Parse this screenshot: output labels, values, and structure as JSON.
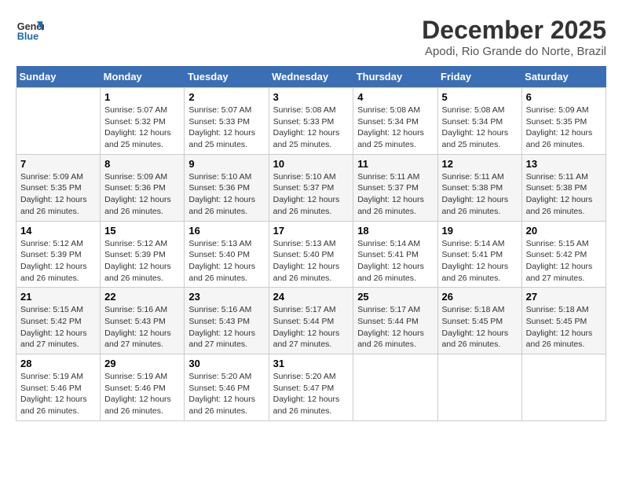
{
  "header": {
    "logo_line1": "General",
    "logo_line2": "Blue",
    "title": "December 2025",
    "subtitle": "Apodi, Rio Grande do Norte, Brazil"
  },
  "calendar": {
    "days_of_week": [
      "Sunday",
      "Monday",
      "Tuesday",
      "Wednesday",
      "Thursday",
      "Friday",
      "Saturday"
    ],
    "weeks": [
      [
        {
          "day": "",
          "info": ""
        },
        {
          "day": "1",
          "info": "Sunrise: 5:07 AM\nSunset: 5:32 PM\nDaylight: 12 hours\nand 25 minutes."
        },
        {
          "day": "2",
          "info": "Sunrise: 5:07 AM\nSunset: 5:33 PM\nDaylight: 12 hours\nand 25 minutes."
        },
        {
          "day": "3",
          "info": "Sunrise: 5:08 AM\nSunset: 5:33 PM\nDaylight: 12 hours\nand 25 minutes."
        },
        {
          "day": "4",
          "info": "Sunrise: 5:08 AM\nSunset: 5:34 PM\nDaylight: 12 hours\nand 25 minutes."
        },
        {
          "day": "5",
          "info": "Sunrise: 5:08 AM\nSunset: 5:34 PM\nDaylight: 12 hours\nand 25 minutes."
        },
        {
          "day": "6",
          "info": "Sunrise: 5:09 AM\nSunset: 5:35 PM\nDaylight: 12 hours\nand 26 minutes."
        }
      ],
      [
        {
          "day": "7",
          "info": "Sunrise: 5:09 AM\nSunset: 5:35 PM\nDaylight: 12 hours\nand 26 minutes."
        },
        {
          "day": "8",
          "info": "Sunrise: 5:09 AM\nSunset: 5:36 PM\nDaylight: 12 hours\nand 26 minutes."
        },
        {
          "day": "9",
          "info": "Sunrise: 5:10 AM\nSunset: 5:36 PM\nDaylight: 12 hours\nand 26 minutes."
        },
        {
          "day": "10",
          "info": "Sunrise: 5:10 AM\nSunset: 5:37 PM\nDaylight: 12 hours\nand 26 minutes."
        },
        {
          "day": "11",
          "info": "Sunrise: 5:11 AM\nSunset: 5:37 PM\nDaylight: 12 hours\nand 26 minutes."
        },
        {
          "day": "12",
          "info": "Sunrise: 5:11 AM\nSunset: 5:38 PM\nDaylight: 12 hours\nand 26 minutes."
        },
        {
          "day": "13",
          "info": "Sunrise: 5:11 AM\nSunset: 5:38 PM\nDaylight: 12 hours\nand 26 minutes."
        }
      ],
      [
        {
          "day": "14",
          "info": "Sunrise: 5:12 AM\nSunset: 5:39 PM\nDaylight: 12 hours\nand 26 minutes."
        },
        {
          "day": "15",
          "info": "Sunrise: 5:12 AM\nSunset: 5:39 PM\nDaylight: 12 hours\nand 26 minutes."
        },
        {
          "day": "16",
          "info": "Sunrise: 5:13 AM\nSunset: 5:40 PM\nDaylight: 12 hours\nand 26 minutes."
        },
        {
          "day": "17",
          "info": "Sunrise: 5:13 AM\nSunset: 5:40 PM\nDaylight: 12 hours\nand 26 minutes."
        },
        {
          "day": "18",
          "info": "Sunrise: 5:14 AM\nSunset: 5:41 PM\nDaylight: 12 hours\nand 26 minutes."
        },
        {
          "day": "19",
          "info": "Sunrise: 5:14 AM\nSunset: 5:41 PM\nDaylight: 12 hours\nand 26 minutes."
        },
        {
          "day": "20",
          "info": "Sunrise: 5:15 AM\nSunset: 5:42 PM\nDaylight: 12 hours\nand 27 minutes."
        }
      ],
      [
        {
          "day": "21",
          "info": "Sunrise: 5:15 AM\nSunset: 5:42 PM\nDaylight: 12 hours\nand 27 minutes."
        },
        {
          "day": "22",
          "info": "Sunrise: 5:16 AM\nSunset: 5:43 PM\nDaylight: 12 hours\nand 27 minutes."
        },
        {
          "day": "23",
          "info": "Sunrise: 5:16 AM\nSunset: 5:43 PM\nDaylight: 12 hours\nand 27 minutes."
        },
        {
          "day": "24",
          "info": "Sunrise: 5:17 AM\nSunset: 5:44 PM\nDaylight: 12 hours\nand 27 minutes."
        },
        {
          "day": "25",
          "info": "Sunrise: 5:17 AM\nSunset: 5:44 PM\nDaylight: 12 hours\nand 26 minutes."
        },
        {
          "day": "26",
          "info": "Sunrise: 5:18 AM\nSunset: 5:45 PM\nDaylight: 12 hours\nand 26 minutes."
        },
        {
          "day": "27",
          "info": "Sunrise: 5:18 AM\nSunset: 5:45 PM\nDaylight: 12 hours\nand 26 minutes."
        }
      ],
      [
        {
          "day": "28",
          "info": "Sunrise: 5:19 AM\nSunset: 5:46 PM\nDaylight: 12 hours\nand 26 minutes."
        },
        {
          "day": "29",
          "info": "Sunrise: 5:19 AM\nSunset: 5:46 PM\nDaylight: 12 hours\nand 26 minutes."
        },
        {
          "day": "30",
          "info": "Sunrise: 5:20 AM\nSunset: 5:46 PM\nDaylight: 12 hours\nand 26 minutes."
        },
        {
          "day": "31",
          "info": "Sunrise: 5:20 AM\nSunset: 5:47 PM\nDaylight: 12 hours\nand 26 minutes."
        },
        {
          "day": "",
          "info": ""
        },
        {
          "day": "",
          "info": ""
        },
        {
          "day": "",
          "info": ""
        }
      ]
    ]
  }
}
